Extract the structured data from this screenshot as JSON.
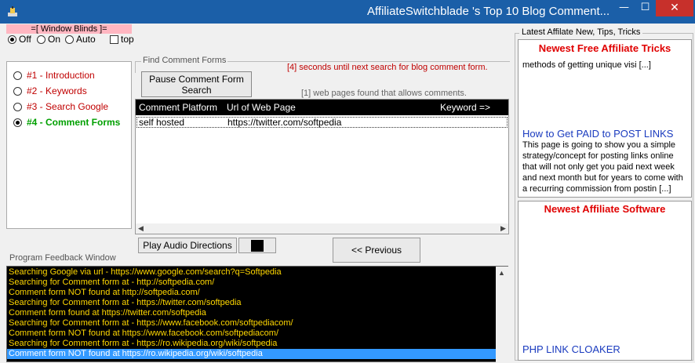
{
  "window": {
    "title": "AffiliateSwitchblade 's Top 10 Blog Comment...",
    "minimize": "—",
    "maximize": "☐",
    "close": "✕"
  },
  "blinds": {
    "label": "=[ Window Blinds ]=",
    "options": [
      "Off",
      "On",
      "Auto"
    ],
    "selected": "Off",
    "top_label": "top"
  },
  "steps": [
    {
      "label": "#1 - Introduction",
      "active": false
    },
    {
      "label": "#2 - Keywords",
      "active": false
    },
    {
      "label": "#3 - Search Google",
      "active": false
    },
    {
      "label": "#4 - Comment Forms",
      "active": true
    }
  ],
  "find": {
    "legend": "Find Comment Forms",
    "pause_button": "Pause Comment Form Search",
    "seconds_text": "[4] seconds until next search for blog comment form.",
    "found_text": "[1] web pages found that allows comments."
  },
  "table": {
    "headers": [
      "Comment Platform",
      "Url of Web Page",
      "Keyword =>"
    ],
    "rows": [
      [
        "self hosted",
        "https://twitter.com/softpedia",
        ""
      ]
    ]
  },
  "buttons": {
    "play": "Play Audio Directions",
    "previous": "<< Previous"
  },
  "feedback": {
    "label": "Program Feedback Window",
    "lines": [
      "Searching Google via url - https://www.google.com/search?q=Softpedia",
      "Searching for Comment form at  - http://softpedia.com/",
      "Comment form NOT found at http://softpedia.com/",
      "Searching for Comment form at  - https://twitter.com/softpedia",
      "Comment form found at https://twitter.com/softpedia",
      "Searching for Comment form at  - https://www.facebook.com/softpediacom/",
      "Comment form NOT found at https://www.facebook.com/softpediacom/",
      "Searching for Comment form at  - https://ro.wikipedia.org/wiki/softpedia",
      "Comment form NOT found at https://ro.wikipedia.org/wiki/softpedia"
    ]
  },
  "sidebar": {
    "legend": "Latest Affilate New, Tips, Tricks",
    "top_heading": "Newest Free Affiliate Tricks",
    "top_snippet": "methods of getting unique visi [...]",
    "post_title": "How to Get PAID to POST LINKS",
    "post_body": "This page is going to show you a simple strategy/concept for posting links online that will not only get you paid next week and next month but for years to come with a recurring commission from postin [...]",
    "bottom_heading": "Newest Affiliate Software",
    "bottom_link": "PHP LINK CLOAKER"
  },
  "colors": {
    "titlebar": "#1b5fa8",
    "close": "#c7302b",
    "step_inactive": "#c00000",
    "step_active": "#00a000",
    "feedback_text": "#ffd700"
  }
}
